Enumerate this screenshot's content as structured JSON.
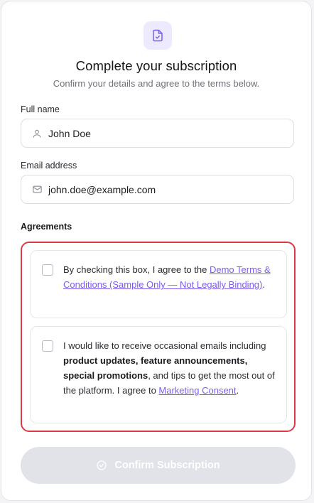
{
  "header": {
    "icon": "document-check-icon",
    "title": "Complete your subscription",
    "subtitle": "Confirm your details and agree to the terms below."
  },
  "form": {
    "full_name": {
      "label": "Full name",
      "icon": "user-icon",
      "value": "John Doe"
    },
    "email": {
      "label": "Email address",
      "icon": "mail-icon",
      "value": "john.doe@example.com"
    }
  },
  "agreements": {
    "label": "Agreements",
    "terms": {
      "checked": false,
      "prefix": "By checking this box, I agree to the ",
      "link_text": "Demo Terms & Conditions (Sample Only — Not Legally Binding)",
      "suffix": "."
    },
    "marketing": {
      "checked": false,
      "prefix": "I would like to receive occasional emails including ",
      "bold_text": "product updates, feature announcements, special promotions",
      "middle": ", and tips to get the most out of the platform. I agree to ",
      "link_text": "Marketing Consent",
      "suffix": "."
    }
  },
  "confirm_button": {
    "label": "Confirm Subscription",
    "icon": "check-circle-icon",
    "disabled": true
  },
  "colors": {
    "accent": "#7c5cf0",
    "error_border": "#dc3b45",
    "disabled_button": "#e2e2e9"
  }
}
